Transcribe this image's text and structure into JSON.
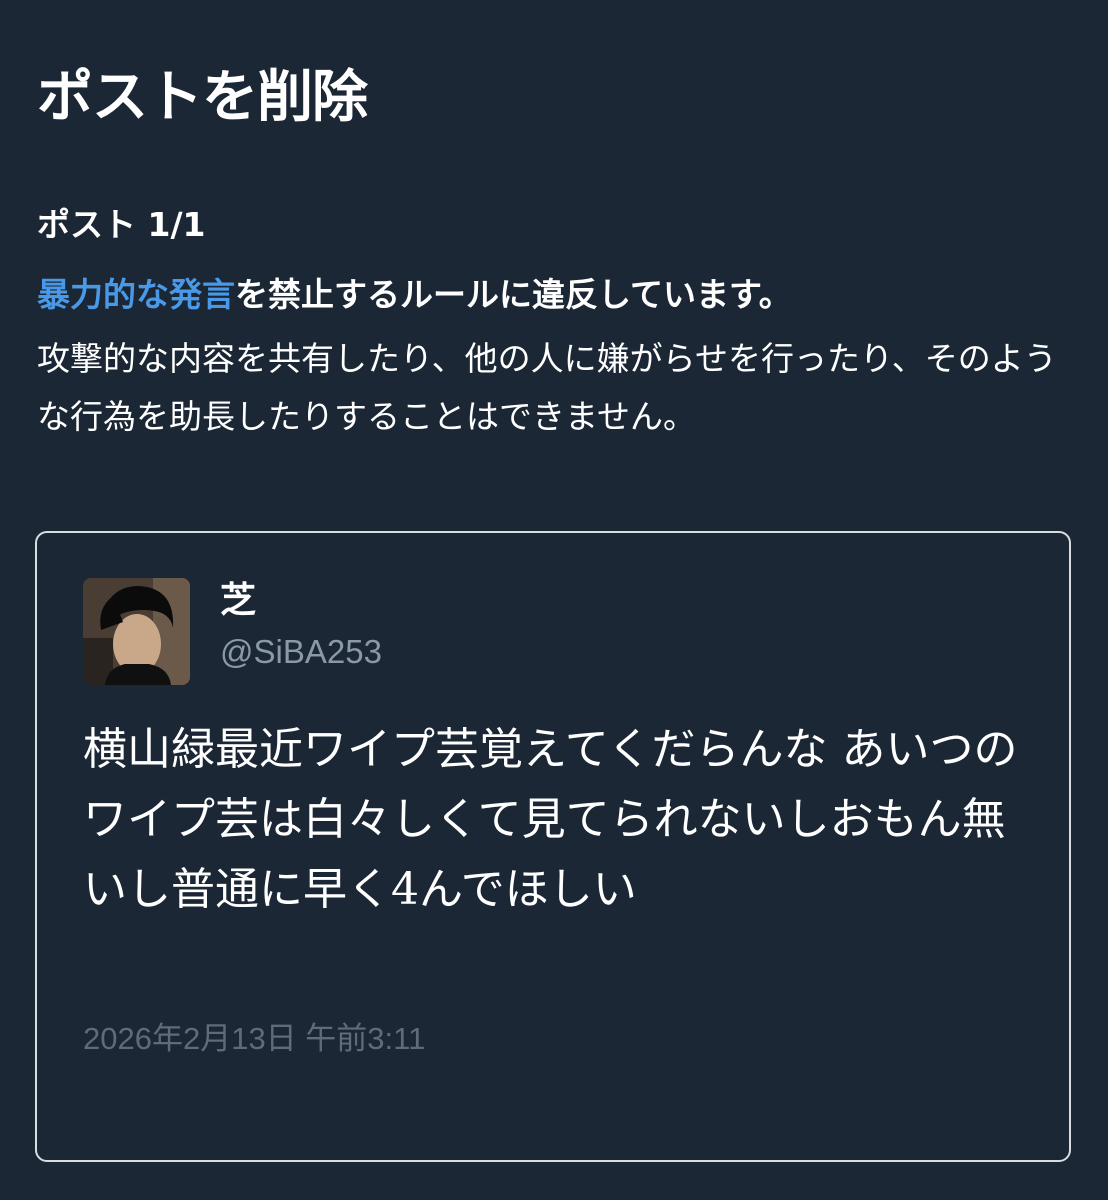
{
  "page": {
    "title": "ポストを削除",
    "post_count_label": "ポスト 1/1"
  },
  "violation": {
    "link_text": "暴力的な発言",
    "rest_text": "を禁止するルールに違反しています。",
    "explanation": "攻撃的な内容を共有したり、他の人に嫌がらせを行ったり、そのような行為を助長したりすることはできません。"
  },
  "post": {
    "author_name": "芝",
    "author_handle": "@SiBA253",
    "body": "横山緑最近ワイプ芸覚えてくだらんな あいつのワイプ芸は白々しくて見てられないしおもん無いし普通に早く4んでほしい",
    "timestamp": "2026年2月13日 午前3:11"
  },
  "colors": {
    "background": "#1b2734",
    "link": "#4a99e9",
    "secondary_text": "#8b98a5",
    "timestamp_text": "#5f6b77",
    "card_border": "#d9dde1"
  }
}
